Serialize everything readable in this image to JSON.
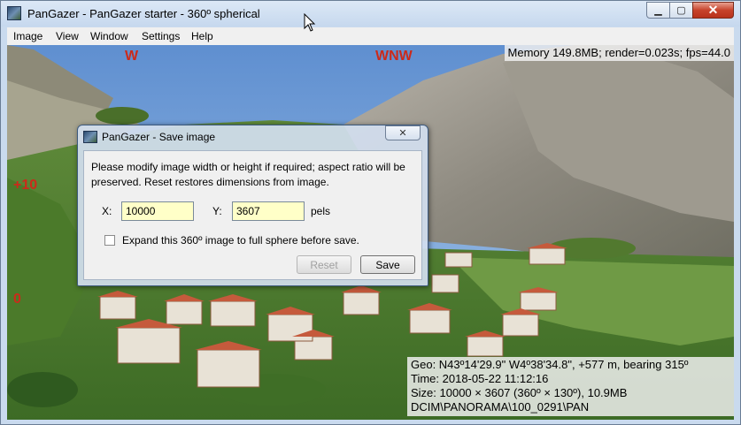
{
  "window": {
    "title": "PanGazer - PanGazer starter - 360º spherical",
    "minimize_glyph": "▁",
    "maximize_glyph": "▢",
    "close_glyph": "✕"
  },
  "menu": {
    "items": [
      {
        "label": "Image"
      },
      {
        "label": "View"
      },
      {
        "label": "Window"
      },
      {
        "label": "Settings"
      },
      {
        "label": "Help"
      }
    ]
  },
  "status": {
    "memory": "Memory 149.8MB; render=0.023s; fps=44.0"
  },
  "compass": {
    "west": "W",
    "wnw": "WNW",
    "elev_plus10": "+10",
    "elev_zero": "0"
  },
  "info": {
    "geo": "Geo: N43º14'29.9\" W4º38'34.8\", +577 m, bearing 315º",
    "time": "Time: 2018-05-22 11:12:16",
    "size": "Size: 10000 × 3607 (360º × 130º), 10.9MB",
    "path": "DCIM\\PANORAMA\\100_0291\\PAN"
  },
  "dialog": {
    "title": "PanGazer - Save image",
    "message": "Please modify image width or height if required; aspect ratio will be preserved.  Reset restores dimensions from image.",
    "x_label": "X:",
    "x_value": "10000",
    "y_label": "Y:",
    "y_value": "3607",
    "unit_label": "pels",
    "checkbox_label": "Expand this 360º image to full sphere before save.",
    "checkbox_checked": false,
    "reset_label": "Reset",
    "save_label": "Save"
  },
  "colors": {
    "compass_red": "#cc2a1a",
    "field_yellow": "#ffffc8",
    "title_blue": "#c9daee"
  }
}
